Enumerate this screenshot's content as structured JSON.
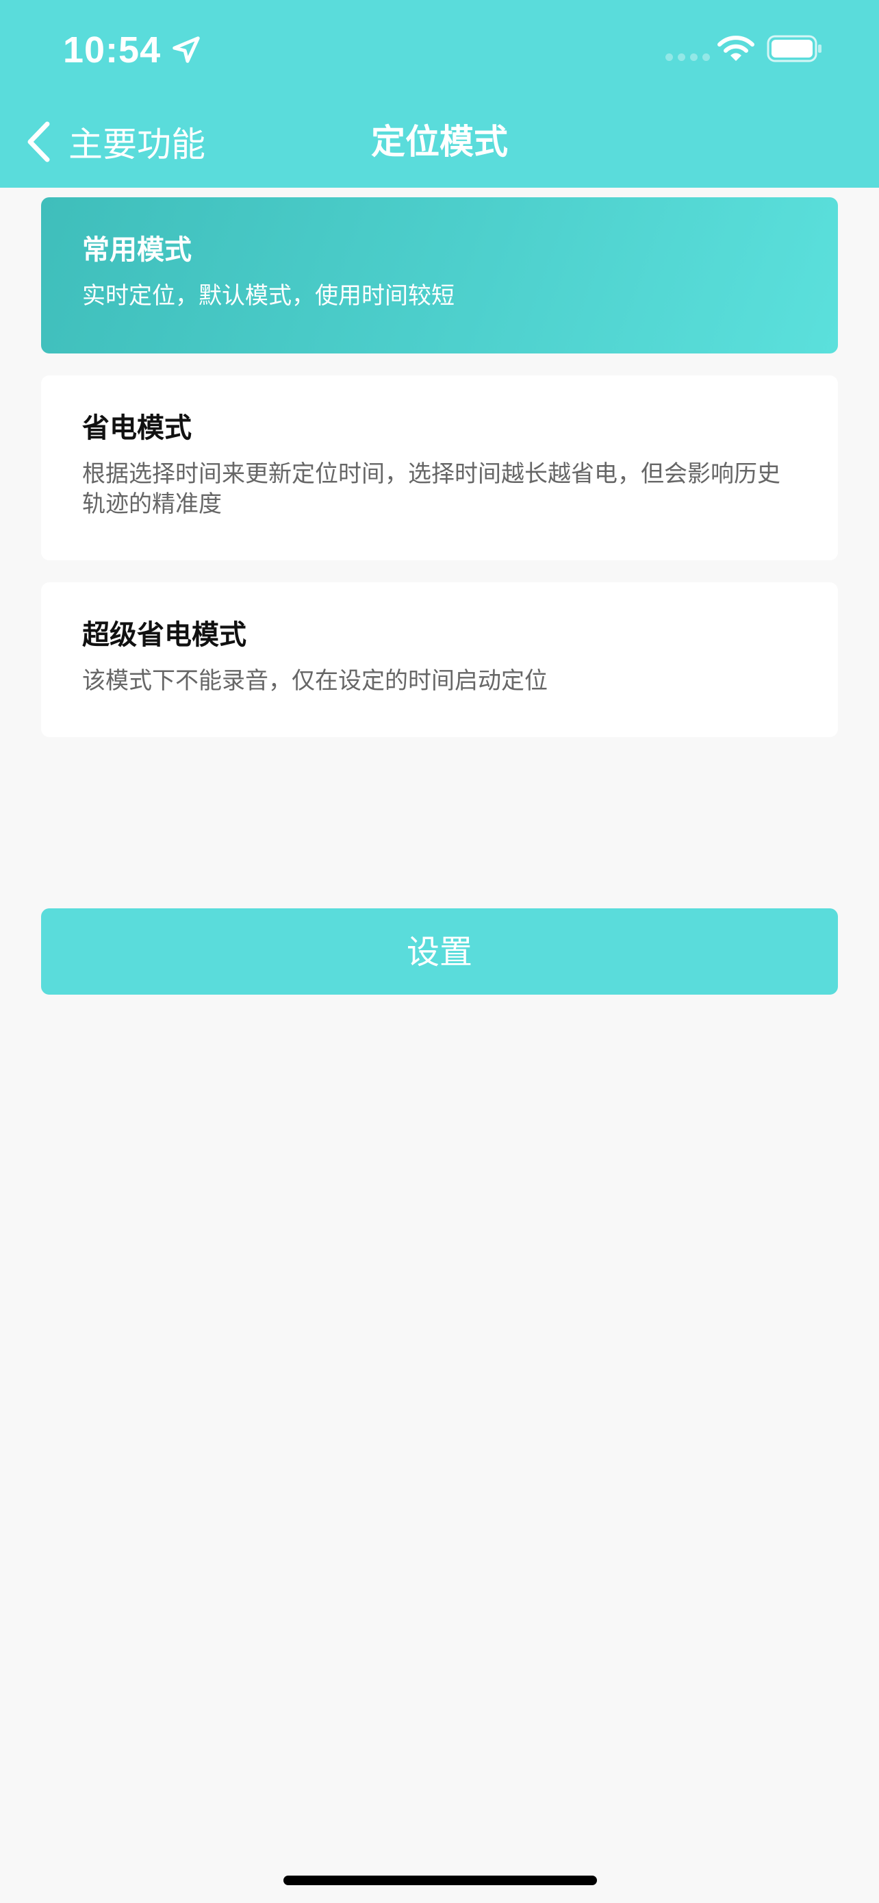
{
  "status_bar": {
    "time": "10:54"
  },
  "nav": {
    "back_label": "主要功能",
    "title": "定位模式"
  },
  "modes": [
    {
      "title": "常用模式",
      "description": "实时定位，默认模式，使用时间较短",
      "selected": true
    },
    {
      "title": "省电模式",
      "description": "根据选择时间来更新定位时间，选择时间越长越省电，但会影响历史轨迹的精准度",
      "selected": false
    },
    {
      "title": "超级省电模式",
      "description": "该模式下不能录音，仅在设定的时间启动定位",
      "selected": false
    }
  ],
  "action": {
    "set_label": "设置"
  },
  "colors": {
    "accent": "#5adcdb",
    "selected_gradient_start": "#3fbebb",
    "selected_gradient_end": "#5be0dc",
    "background": "#f8f8f8"
  }
}
